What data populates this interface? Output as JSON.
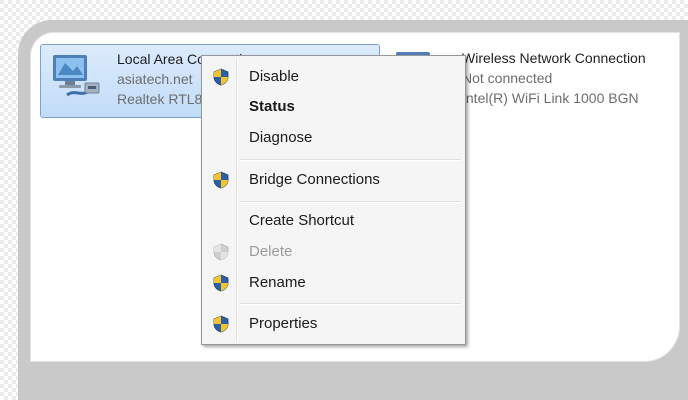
{
  "connections": [
    {
      "name": "Local Area Connection",
      "status": "asiatech.net",
      "device": "Realtek RTL8",
      "selected": true
    },
    {
      "name": "Wireless Network Connection",
      "status": "Not connected",
      "device": "Intel(R) WiFi Link 1000 BGN",
      "selected": false
    }
  ],
  "context_menu": {
    "items": [
      {
        "label": "Disable",
        "icon": "uac-shield-icon",
        "bold": false,
        "enabled": true
      },
      {
        "label": "Status",
        "icon": null,
        "bold": true,
        "enabled": true
      },
      {
        "label": "Diagnose",
        "icon": null,
        "bold": false,
        "enabled": true
      },
      {
        "label": "Bridge Connections",
        "icon": "uac-shield-icon",
        "bold": false,
        "enabled": true
      },
      {
        "label": "Create Shortcut",
        "icon": null,
        "bold": false,
        "enabled": true
      },
      {
        "label": "Delete",
        "icon": "uac-shield-icon",
        "bold": false,
        "enabled": false
      },
      {
        "label": "Rename",
        "icon": "uac-shield-icon",
        "bold": false,
        "enabled": true
      },
      {
        "label": "Properties",
        "icon": "uac-shield-icon",
        "bold": false,
        "enabled": true
      }
    ]
  },
  "colors": {
    "selection": "#c9def7",
    "menu_background": "#f5f5f5",
    "disabled_text": "#9b9b9b"
  }
}
